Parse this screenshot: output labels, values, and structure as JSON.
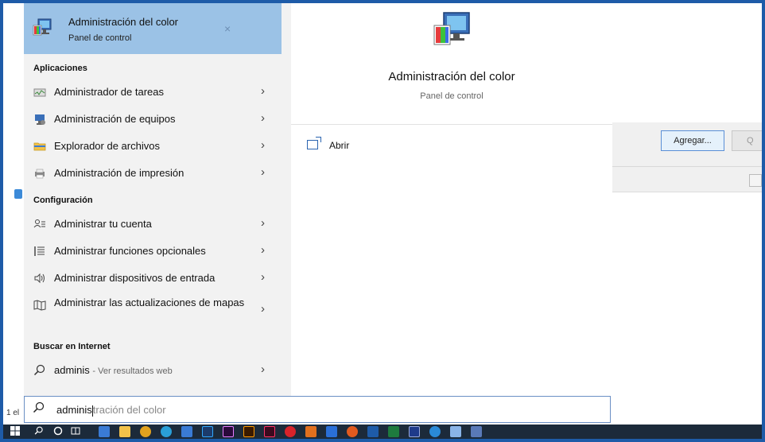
{
  "best_match": {
    "title": "Administración del color",
    "subtitle": "Panel de control",
    "close_glyph": "×"
  },
  "sections": {
    "apps": "Aplicaciones",
    "settings": "Configuración",
    "web": "Buscar en Internet"
  },
  "apps": [
    {
      "label": "Administrador de tareas",
      "icon": "task-manager-icon"
    },
    {
      "label": "Administración de equipos",
      "icon": "computer-management-icon"
    },
    {
      "label": "Explorador de archivos",
      "icon": "folder-icon"
    },
    {
      "label": "Administración de impresión",
      "icon": "printer-icon"
    }
  ],
  "settings": [
    {
      "label": "Administrar tu cuenta",
      "icon": "account-icon"
    },
    {
      "label": "Administrar funciones opcionales",
      "icon": "list-icon"
    },
    {
      "label": "Administrar dispositivos de entrada",
      "icon": "speaker-icon"
    },
    {
      "label": "Administrar las actualizaciones de mapas",
      "icon": "map-icon"
    }
  ],
  "web": {
    "query": "adminis",
    "hint": "- Ver resultados web"
  },
  "preview": {
    "title": "Administración del color",
    "subtitle": "Panel de control",
    "open_label": "Abrir"
  },
  "search": {
    "typed": "adminis",
    "ghost": "tración del color"
  },
  "background": {
    "add_button": "Agregar...",
    "second_button": "Q",
    "status": "1 el"
  },
  "colors": {
    "accent": "#1e5ba8",
    "selection": "#9bc2e6"
  }
}
